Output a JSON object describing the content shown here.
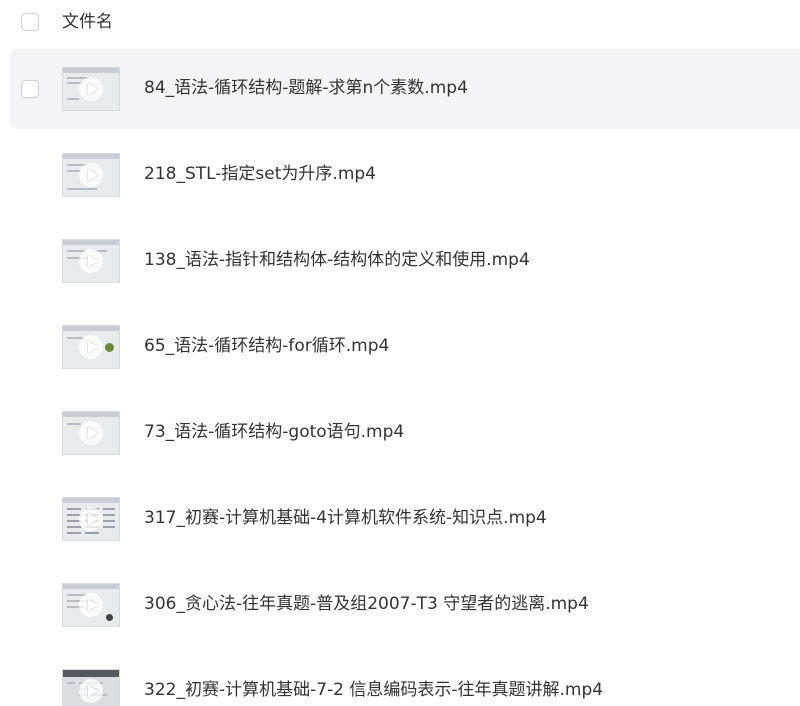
{
  "header": {
    "column_label": "文件名"
  },
  "files": [
    {
      "name": "84_语法-循环结构-题解-求第n个素数.mp4",
      "thumb_icon": "video-thumbnail-icon"
    },
    {
      "name": "218_STL-指定set为升序.mp4",
      "thumb_icon": "video-thumbnail-icon"
    },
    {
      "name": "138_语法-指针和结构体-结构体的定义和使用.mp4",
      "thumb_icon": "video-thumbnail-icon"
    },
    {
      "name": "65_语法-循环结构-for循环.mp4",
      "thumb_icon": "video-thumbnail-icon"
    },
    {
      "name": "73_语法-循环结构-goto语句.mp4",
      "thumb_icon": "video-thumbnail-icon"
    },
    {
      "name": "317_初赛-计算机基础-4计算机软件系统-知识点.mp4",
      "thumb_icon": "video-thumbnail-icon"
    },
    {
      "name": "306_贪心法-往年真题-普及组2007-T3 守望者的逃离.mp4",
      "thumb_icon": "video-thumbnail-icon"
    },
    {
      "name": "322_初赛-计算机基础-7-2 信息编码表示-往年真题讲解.mp4",
      "thumb_icon": "video-thumbnail-icon"
    }
  ],
  "colors": {
    "hover_row_bg": "#f4f4f6",
    "text": "#333333",
    "checkbox_border": "#cfcfd4"
  }
}
